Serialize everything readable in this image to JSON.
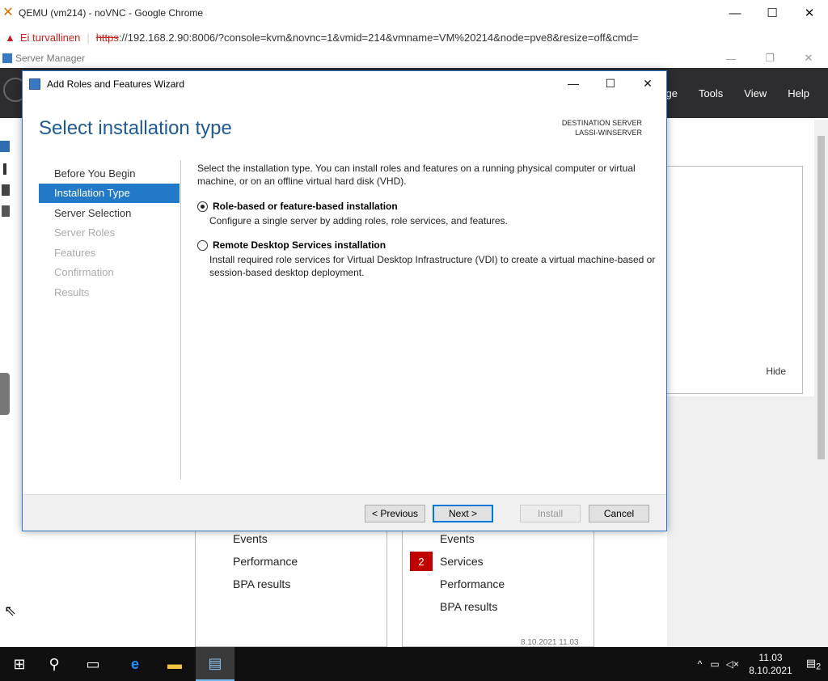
{
  "browser": {
    "title": "QEMU (vm214) - noVNC - Google Chrome",
    "icon": "proxmox-x-icon",
    "warn_label": "Ei turvallinen",
    "url_scheme": "https",
    "url_rest": "://192.168.2.90:8006/?console=kvm&novnc=1&vmid=214&vmname=VM%20214&node=pve8&resize=off&cmd="
  },
  "server_manager": {
    "title": "Server Manager",
    "menu": [
      "age",
      "Tools",
      "View",
      "Help"
    ],
    "hide_label": "Hide",
    "panel_left": [
      "Events",
      "Performance",
      "BPA results"
    ],
    "panel_right": [
      "Events",
      "Services",
      "Performance",
      "BPA results"
    ],
    "services_badge": "2",
    "timestamp": "8.10.2021 11.03"
  },
  "wizard": {
    "title": "Add Roles and Features Wizard",
    "heading": "Select installation type",
    "destination_label": "DESTINATION SERVER",
    "destination_server": "LASSI-WINSERVER",
    "nav": [
      {
        "label": "Before You Begin",
        "state": "normal"
      },
      {
        "label": "Installation Type",
        "state": "active"
      },
      {
        "label": "Server Selection",
        "state": "normal"
      },
      {
        "label": "Server Roles",
        "state": "disabled"
      },
      {
        "label": "Features",
        "state": "disabled"
      },
      {
        "label": "Confirmation",
        "state": "disabled"
      },
      {
        "label": "Results",
        "state": "disabled"
      }
    ],
    "intro": "Select the installation type. You can install roles and features on a running physical computer or virtual machine, or on an offline virtual hard disk (VHD).",
    "options": [
      {
        "label": "Role-based or feature-based installation",
        "description": "Configure a single server by adding roles, role services, and features.",
        "selected": true
      },
      {
        "label": "Remote Desktop Services installation",
        "description": "Install required role services for Virtual Desktop Infrastructure (VDI) to create a virtual machine-based or session-based desktop deployment.",
        "selected": false
      }
    ],
    "buttons": {
      "previous": "< Previous",
      "next": "Next >",
      "install": "Install",
      "cancel": "Cancel"
    }
  },
  "taskbar": {
    "time": "11.03",
    "date": "8.10.2021",
    "notifications": "2"
  }
}
